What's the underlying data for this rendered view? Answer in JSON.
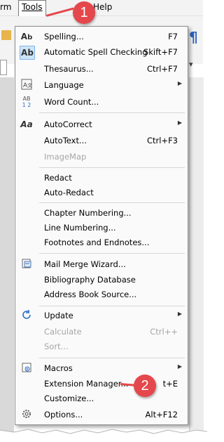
{
  "menubar": {
    "form_fragment": "rm",
    "tools": "Tools",
    "help": "Help"
  },
  "menu": {
    "items": [
      {
        "label": "Spelling...",
        "shortcut": "F7",
        "icon": "spelling-icon"
      },
      {
        "label": "Automatic Spell Checking",
        "shortcut": "Skift+F7",
        "icon": "auto-spellcheck-icon"
      },
      {
        "label": "Thesaurus...",
        "shortcut": "Ctrl+F7",
        "icon": ""
      },
      {
        "label": "Language",
        "shortcut": "",
        "icon": "language-icon",
        "submenu": true
      },
      {
        "label": "Word Count...",
        "shortcut": "",
        "icon": "word-count-icon"
      },
      {
        "label": "AutoCorrect",
        "shortcut": "",
        "icon": "autocorrect-icon",
        "submenu": true
      },
      {
        "label": "AutoText...",
        "shortcut": "Ctrl+F3",
        "icon": ""
      },
      {
        "label": "ImageMap",
        "shortcut": "",
        "icon": "",
        "disabled": true
      },
      {
        "label": "Redact",
        "shortcut": "",
        "icon": ""
      },
      {
        "label": "Auto-Redact",
        "shortcut": "",
        "icon": ""
      },
      {
        "label": "Chapter Numbering...",
        "shortcut": "",
        "icon": ""
      },
      {
        "label": "Line Numbering...",
        "shortcut": "",
        "icon": ""
      },
      {
        "label": "Footnotes and Endnotes...",
        "shortcut": "",
        "icon": ""
      },
      {
        "label": "Mail Merge Wizard...",
        "shortcut": "",
        "icon": "mail-merge-icon"
      },
      {
        "label": "Bibliography Database",
        "shortcut": "",
        "icon": ""
      },
      {
        "label": "Address Book Source...",
        "shortcut": "",
        "icon": ""
      },
      {
        "label": "Update",
        "shortcut": "",
        "icon": "update-icon",
        "submenu": true
      },
      {
        "label": "Calculate",
        "shortcut": "Ctrl++",
        "icon": "",
        "disabled": true
      },
      {
        "label": "Sort...",
        "shortcut": "",
        "icon": "",
        "disabled": true
      },
      {
        "label": "Macros",
        "shortcut": "",
        "icon": "macros-icon",
        "submenu": true
      },
      {
        "label": "Extension Manager...",
        "shortcut": "t+E",
        "icon": ""
      },
      {
        "label": "Customize...",
        "shortcut": "",
        "icon": ""
      },
      {
        "label": "Options...",
        "shortcut": "Alt+F12",
        "icon": "gear-icon"
      }
    ]
  },
  "callouts": {
    "one": "1",
    "two": "2"
  },
  "colors": {
    "callout": "#e4484c",
    "menu_bg": "#fafafa",
    "disabled_text": "#a6a6a6"
  }
}
